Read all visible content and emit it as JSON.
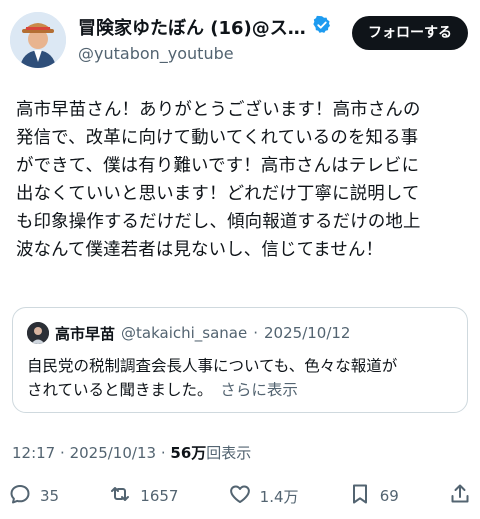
{
  "header": {
    "display_name": "冒険家ゆたぼん (16)@スタ...",
    "handle": "@yutabon_youtube",
    "verified_icon": "verified-badge-icon",
    "follow_label": "フォローする"
  },
  "tweet": {
    "text": "高市早苗さん！ありがとうございます！高市さんの\n発信で、改革に向けて動いてくれているのを知る事\nができて、僕は有り難いです！高市さんはテレビに\n出なくていいと思います！どれだけ丁寧に説明して\nも印象操作するだけだし、傾向報道するだけの地上\n波なんて僕達若者は見ないし、信じてません！"
  },
  "quote": {
    "name": "高市早苗",
    "handle": "@takaichi_sanae",
    "separator": "·",
    "date": "2025/10/12",
    "text": "自民党の税制調査会長人事についても、色々な報道が\nされていると聞きました。",
    "show_more": "さらに表示"
  },
  "timestamp": {
    "time": "12:17",
    "separator": "·",
    "date": "2025/10/13",
    "dot": "·",
    "views": "56万",
    "views_label": "回表示"
  },
  "actions": {
    "reply_count": "35",
    "retweet_count": "1657",
    "like_count": "1.4万",
    "bookmark_count": "69"
  },
  "colors": {
    "text": "#0f1419",
    "secondary": "#536471",
    "verified": "#1d9bf0",
    "border": "#cfd9de"
  }
}
